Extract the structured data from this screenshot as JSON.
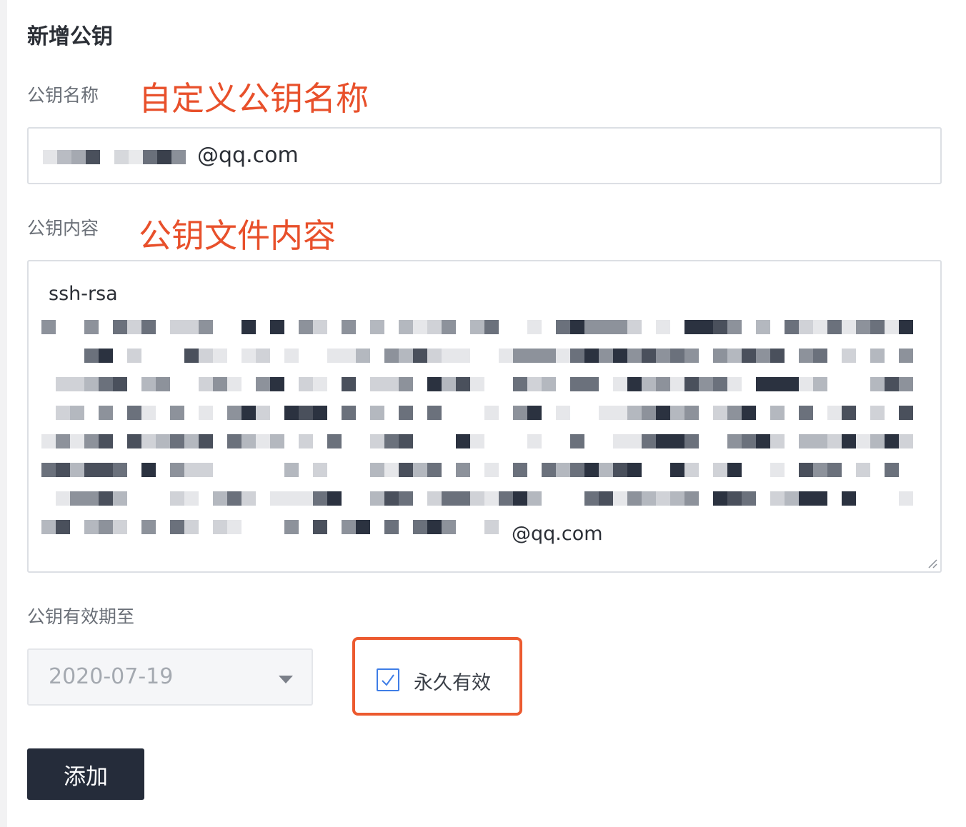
{
  "form": {
    "title": "新增公钥",
    "name_label": "公钥名称",
    "name_value_visible": "@qq.com",
    "content_label": "公钥内容",
    "content_first_line": "ssh-rsa",
    "content_last_visible": "@qq.com",
    "expiry_label": "公钥有效期至",
    "expiry_date": "2020-07-19",
    "permanent_label": "永久有效",
    "permanent_checked": true,
    "submit_label": "添加"
  },
  "annotations": {
    "name_note": "自定义公钥名称",
    "content_note": "公钥文件内容"
  },
  "colors": {
    "annotation": "#e8502b",
    "highlight_border": "#ec5a2f",
    "checkbox": "#3e7de6",
    "button_bg": "#252c3a"
  }
}
